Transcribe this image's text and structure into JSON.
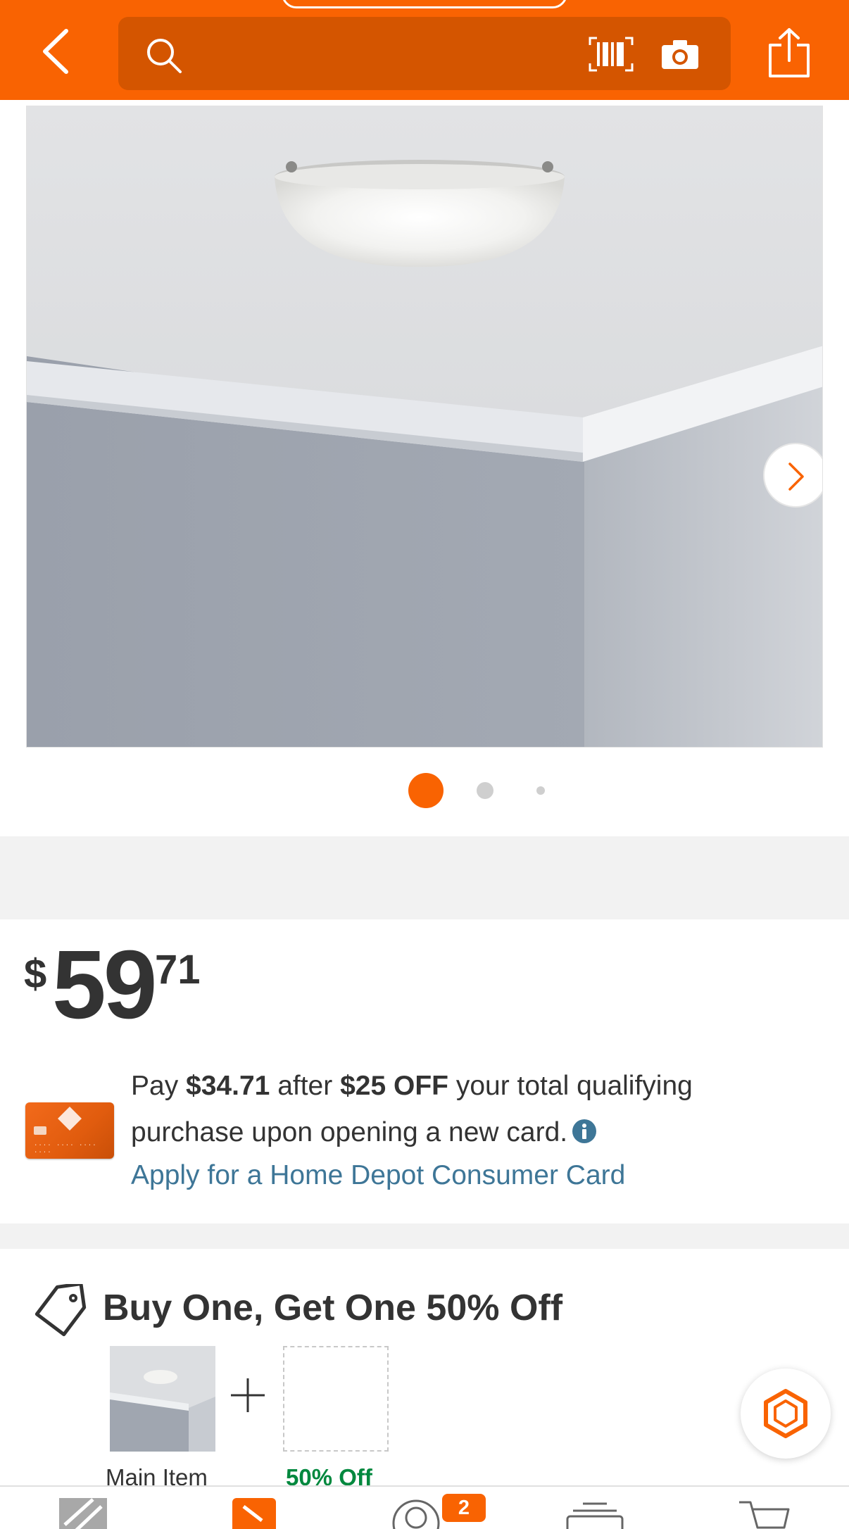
{
  "header": {
    "search": {
      "placeholder": ""
    },
    "icons": [
      "back-chevron-icon",
      "search-icon",
      "barcode-scan-icon",
      "camera-icon",
      "share-icon"
    ]
  },
  "gallery": {
    "image_count": 3,
    "active_index": 0,
    "next_icon": "chevron-right-icon"
  },
  "price": {
    "dollar_sign": "$",
    "whole": "59",
    "cents": "71"
  },
  "credit_promo": {
    "text_pay": "Pay",
    "amount_after": "$34.71",
    "text_after": "after",
    "discount": "$25 OFF",
    "text_rest": "your total qualifying purchase upon opening a new card.",
    "apply_link": "Apply for a Home Depot Consumer Card"
  },
  "bogo": {
    "title": "Buy One, Get One 50% Off",
    "main_item_label": "Main Item",
    "discount_item_label": "50% Off"
  },
  "bottom_nav": {
    "me_badge": "2"
  },
  "colors": {
    "brand_orange": "#f96302",
    "link_blue": "#3e7697",
    "discount_green": "#00883e"
  }
}
